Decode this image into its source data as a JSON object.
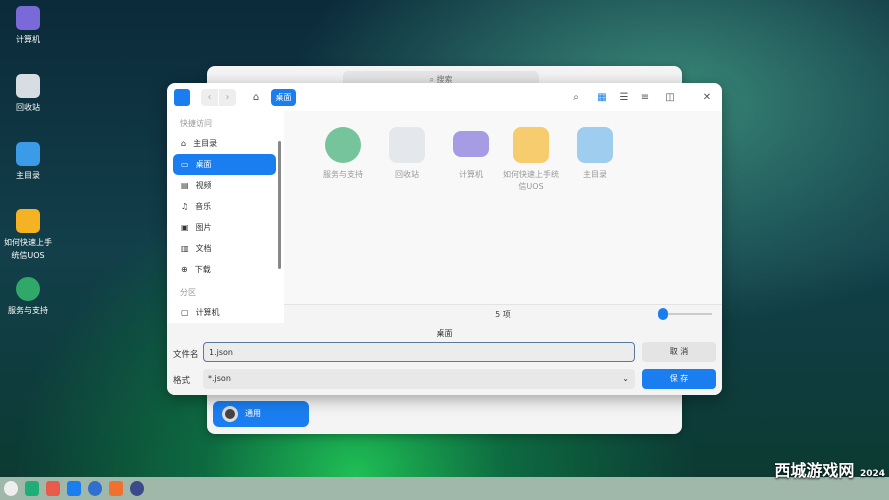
{
  "desktop": {
    "icons": [
      {
        "label": "计算机",
        "color": "#7a6ad8"
      },
      {
        "label": "回收站",
        "color": "#d8dde3"
      },
      {
        "label": "主目录",
        "color": "#3b9be6"
      },
      {
        "label": "如何快速上手统信UOS",
        "color": "#f5b324"
      },
      {
        "label": "服务与支持",
        "color": "#2fa86a"
      }
    ]
  },
  "background_window": {
    "search_placeholder": "搜索",
    "selected_item": "通用"
  },
  "dialog": {
    "breadcrumb": "桌面",
    "sidebar": {
      "quick_access_header": "快捷访问",
      "items": [
        {
          "label": "主目录",
          "icon": "home-icon"
        },
        {
          "label": "桌面",
          "icon": "desktop-icon",
          "active": true
        },
        {
          "label": "视频",
          "icon": "video-icon"
        },
        {
          "label": "音乐",
          "icon": "music-icon"
        },
        {
          "label": "图片",
          "icon": "image-icon"
        },
        {
          "label": "文档",
          "icon": "document-icon"
        },
        {
          "label": "下载",
          "icon": "download-icon"
        }
      ],
      "partition_header": "分区",
      "partition_items": [
        {
          "label": "计算机"
        }
      ]
    },
    "files": [
      {
        "label": "服务与支持",
        "color": "#2fa86a"
      },
      {
        "label": "回收站",
        "color": "#d8dde3"
      },
      {
        "label": "计算机",
        "color": "#7a6ad8"
      },
      {
        "label": "如何快速上手统信UOS",
        "color": "#f5b324"
      },
      {
        "label": "主目录",
        "color": "#6fb6ea"
      }
    ],
    "status": "5 项",
    "current_dir": "桌面",
    "filename_label": "文件名",
    "filename_value": "1.json",
    "format_label": "格式",
    "format_value": "*.json",
    "cancel": "取 消",
    "save": "保 存",
    "accent": "#1a7ef0"
  },
  "watermark": {
    "text": "西城游戏网",
    "year": "2024"
  }
}
